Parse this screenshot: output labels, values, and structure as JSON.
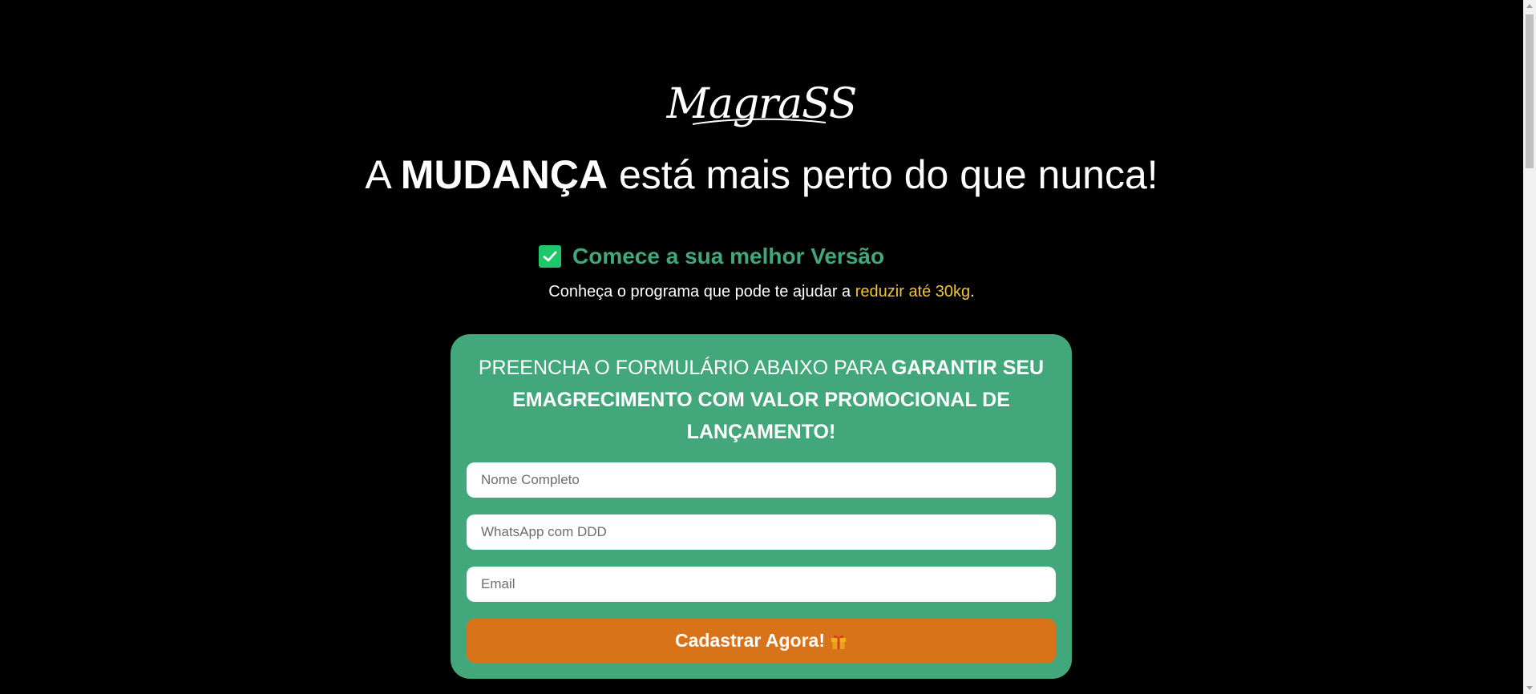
{
  "brand": {
    "logo_text": "MagraSS"
  },
  "hero": {
    "headline_pre": "A ",
    "headline_bold": "MUDANÇA",
    "headline_post": " está mais perto do que nunca!"
  },
  "highlight": {
    "check_label": "Comece a sua melhor Versão",
    "sub_pre": "Conheça o programa que pode te ajudar a ",
    "sub_highlight": "reduzir até 30kg",
    "sub_post": "."
  },
  "form": {
    "title_regular": "PREENCHA O FORMULÁRIO ABAIXO PARA ",
    "title_bold": "GARANTIR SEU EMAGRECIMENTO COM VALOR PROMOCIONAL DE LANÇAMENTO!",
    "name_placeholder": "Nome Completo",
    "phone_placeholder": "WhatsApp com DDD",
    "email_placeholder": "Email",
    "submit_label": "Cadastrar Agora!",
    "submit_icon": "gift-icon"
  },
  "colors": {
    "background": "#000000",
    "card": "#42a87c",
    "check_green": "#1ec76a",
    "check_text": "#41a87c",
    "highlight_yellow": "#f2c531",
    "button_orange": "#d9731a"
  }
}
